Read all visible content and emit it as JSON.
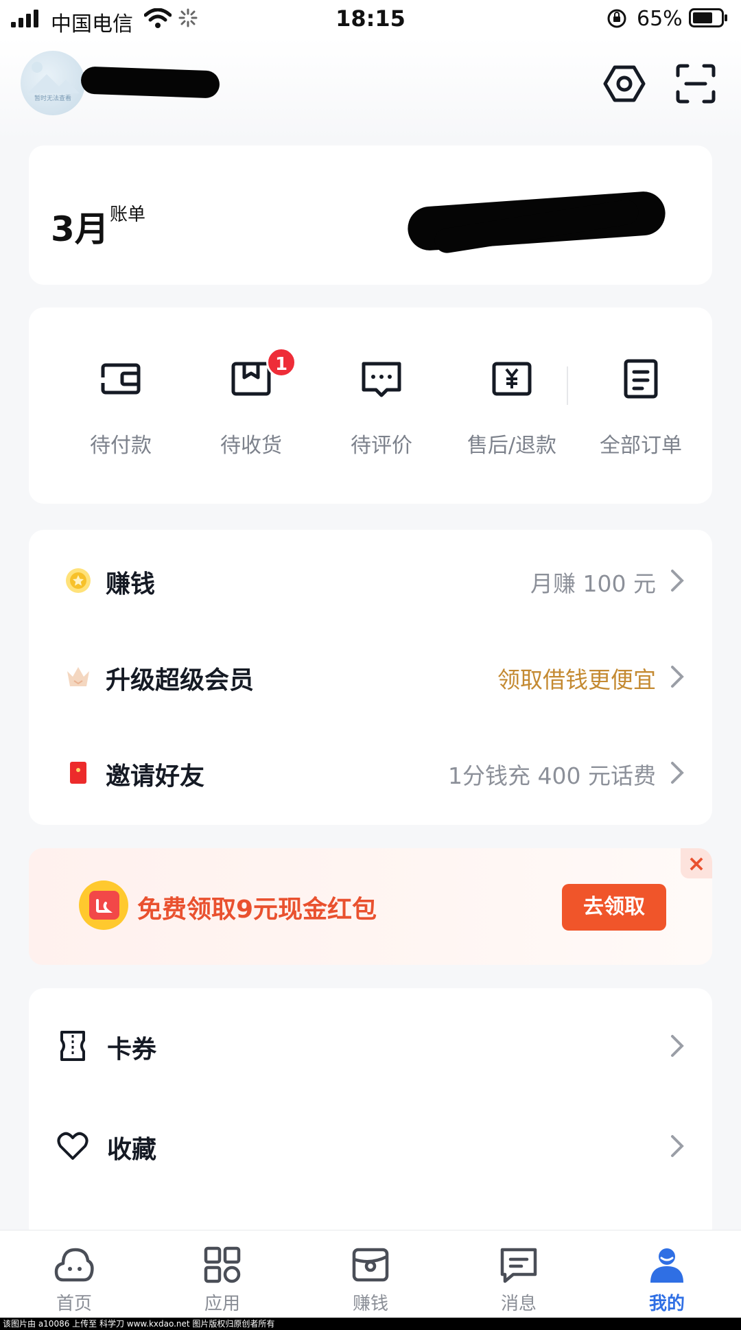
{
  "status_bar": {
    "carrier": "中国电信",
    "time": "18:15",
    "battery_percent": "65%"
  },
  "header": {
    "avatar_caption": "暂时无法查看",
    "icons": [
      "settings-hexagon-icon",
      "scan-icon"
    ]
  },
  "bill": {
    "month": "3月",
    "label": "账单"
  },
  "orders": {
    "items": [
      {
        "label": "待付款",
        "icon": "wallet-icon"
      },
      {
        "label": "待收货",
        "icon": "package-icon",
        "badge": "1"
      },
      {
        "label": "待评价",
        "icon": "comment-icon"
      },
      {
        "label": "售后/退款",
        "icon": "refund-icon"
      },
      {
        "label": "全部订单",
        "icon": "order-list-icon"
      }
    ]
  },
  "menu": {
    "rows": [
      {
        "title": "赚钱",
        "value": "月赚 100 元",
        "icon": "gold-coin-icon"
      },
      {
        "title": "升级超级会员",
        "value": "领取借钱更便宜",
        "icon": "crown-icon",
        "value_color": "#c48a32"
      },
      {
        "title": "邀请好友",
        "value": "1分钱充 400 元话费",
        "icon": "red-envelope-icon"
      }
    ]
  },
  "promo": {
    "text": "免费领取9元现金红包",
    "button": "去领取",
    "close": "×"
  },
  "list": {
    "rows": [
      {
        "title": "卡券",
        "icon": "coupon-icon"
      },
      {
        "title": "收藏",
        "icon": "heart-icon"
      }
    ]
  },
  "tabbar": {
    "tabs": [
      {
        "label": "首页",
        "icon": "home-cloud-icon"
      },
      {
        "label": "应用",
        "icon": "apps-grid-icon"
      },
      {
        "label": "赚钱",
        "icon": "earn-wallet-icon"
      },
      {
        "label": "消息",
        "icon": "message-icon"
      },
      {
        "label": "我的",
        "icon": "profile-icon",
        "active": true
      }
    ]
  },
  "footer_strip": "该图片由 a10086 上传至 科学刀 www.kxdao.net 图片版权归原创者所有",
  "colors": {
    "accent": "#2f6fe4",
    "promo_orange": "#f0552a",
    "badge_red": "#ee2d38",
    "gold": "#c48a32"
  }
}
